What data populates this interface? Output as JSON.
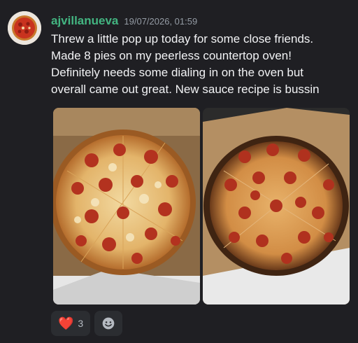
{
  "message": {
    "author": "ajvillanueva",
    "timestamp": "19/07/2026, 01:59",
    "author_color": "#43b581",
    "lines": [
      "Threw a little pop up today for some close friends.",
      "Made 8 pies on my peerless countertop oven!",
      "Definitely needs some dialing in on the oven but",
      "overall came out great. New sauce recipe is bussin"
    ],
    "attachments": [
      {
        "icon": "pepperoni-pizza-photo-1"
      },
      {
        "icon": "pepperoni-pizza-photo-2"
      }
    ],
    "reactions": [
      {
        "emoji": "❤️",
        "emoji_name": "heart-emoji-icon",
        "count": "3"
      }
    ],
    "add_reaction_icon": "smiley-add-reaction-icon"
  }
}
